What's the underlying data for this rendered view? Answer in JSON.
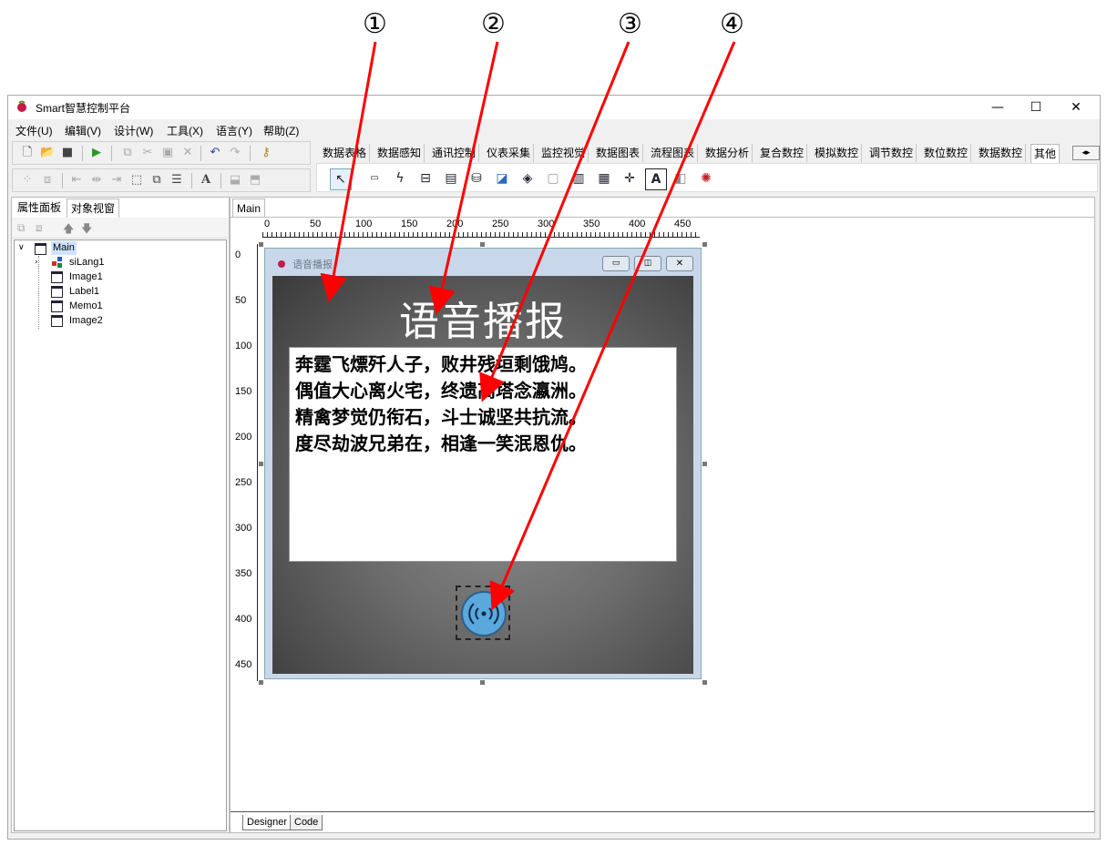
{
  "callouts": [
    "①",
    "②",
    "③",
    "④"
  ],
  "app": {
    "title": "Smart智慧控制平台",
    "window_controls": {
      "minimize": "—",
      "maximize": "☐",
      "close": "✕"
    }
  },
  "menu": [
    "文件(U)",
    "编辑(V)",
    "设计(W)",
    "工具(X)",
    "语言(Y)",
    "帮助(Z)"
  ],
  "component_tabs": [
    "数据表格",
    "数据感知",
    "通讯控制",
    "仪表采集",
    "监控视觉",
    "数据图表",
    "流程图表",
    "数据分析",
    "复合数控",
    "模拟数控",
    "调节数控",
    "数位数控",
    "数据数控",
    "其他"
  ],
  "component_tabs_active": "其他",
  "left_panel": {
    "tabs": [
      "属性面板",
      "对象视窗"
    ],
    "tree": [
      {
        "label": "Main",
        "level": 0
      },
      {
        "label": "siLang1",
        "level": 1
      },
      {
        "label": "Image1",
        "level": 1
      },
      {
        "label": "Label1",
        "level": 1
      },
      {
        "label": "Memo1",
        "level": 1
      },
      {
        "label": "Image2",
        "level": 1
      }
    ]
  },
  "designer": {
    "tab": "Main",
    "ruler_h": [
      "0",
      "50",
      "100",
      "150",
      "200",
      "250",
      "300",
      "350",
      "400",
      "450"
    ],
    "ruler_v": [
      "0",
      "50",
      "100",
      "150",
      "200",
      "250",
      "300",
      "350",
      "400",
      "450"
    ],
    "bottom_tabs": [
      "Designer",
      "Code"
    ]
  },
  "form": {
    "title": "语音播报",
    "label_text": "语音播报",
    "memo_lines": [
      "奔霆飞熛歼人子，败井残垣剩饿鸠。",
      "偶值大心离火宅，终遗高塔念瀛洲。",
      "精禽梦觉仍衔石，斗士诚坚共抗流。",
      "度尽劫波兄弟在，相逢一笑泯恩仇。"
    ]
  },
  "colors": {
    "arrow": "#ff0000",
    "tts_icon": "#5ba8dc",
    "accent_bar": "#2a8a2a"
  }
}
